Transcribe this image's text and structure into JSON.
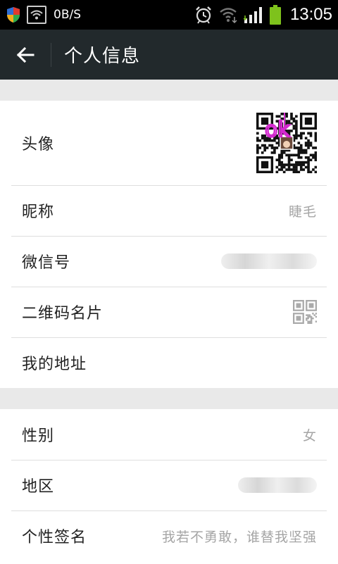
{
  "status_bar": {
    "net_speed": "0B/S",
    "time": "13:05",
    "icons": [
      "security-shield-icon",
      "wifi-hotspot-icon",
      "alarm-icon",
      "wifi-icon",
      "signal-icon",
      "battery-icon"
    ]
  },
  "action_bar": {
    "back_icon": "arrow-left-icon",
    "title": "个人信息"
  },
  "profile": {
    "avatar_label": "头像",
    "avatar_overlay_text": "ok",
    "nickname_label": "昵称",
    "nickname_value": "睫毛",
    "wechat_id_label": "微信号",
    "qr_card_label": "二维码名片",
    "address_label": "我的地址"
  },
  "details": {
    "gender_label": "性别",
    "gender_value": "女",
    "region_label": "地区",
    "signature_label": "个性签名",
    "signature_value": "我若不勇敢，谁替我坚强"
  },
  "colors": {
    "status_bar": "#000000",
    "action_bar": "#22292c",
    "background": "#e9e9e9",
    "battery_green": "#7ec21c",
    "signal_green": "#7ec21c",
    "overlay_magenta": "#d42ad0"
  }
}
